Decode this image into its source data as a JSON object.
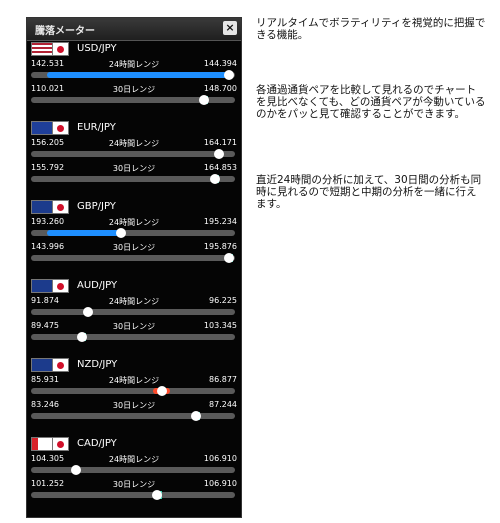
{
  "widget": {
    "title": "騰落メーター",
    "close_label": "×"
  },
  "range_labels": {
    "day": "24時間レンジ",
    "month": "30日レンジ"
  },
  "pairs": [
    {
      "name": "USD/JPY",
      "flag": "us-flag",
      "d_low": "142.531",
      "d_high": "144.394",
      "d_level": 0.97,
      "m_low": "110.021",
      "m_high": "148.700",
      "m_level": 0.85,
      "day_fill": "blue"
    },
    {
      "name": "EUR/JPY",
      "flag": "eu-flag",
      "d_low": "156.205",
      "d_high": "164.171",
      "d_level": 0.92,
      "m_low": "155.792",
      "m_high": "164.853",
      "m_level": 0.9,
      "day_fill": "none"
    },
    {
      "name": "GBP/JPY",
      "flag": "uk-flag",
      "d_low": "193.260",
      "d_high": "195.234",
      "d_level": 0.44,
      "m_low": "143.996",
      "m_high": "195.876",
      "m_level": 0.97,
      "day_fill": "blue"
    },
    {
      "name": "AUD/JPY",
      "flag": "au-flag",
      "d_low": "91.874",
      "d_high": "96.225",
      "d_level": 0.28,
      "m_low": "89.475",
      "m_high": "103.345",
      "m_level": 0.25,
      "day_fill": "none"
    },
    {
      "name": "NZD/JPY",
      "flag": "nz-flag",
      "d_low": "85.931",
      "d_high": "86.877",
      "d_level": 0.64,
      "m_low": "83.246",
      "m_high": "87.244",
      "m_level": 0.81,
      "day_fill": "red"
    },
    {
      "name": "CAD/JPY",
      "flag": "ca-flag",
      "d_low": "104.305",
      "d_high": "106.910",
      "d_level": 0.22,
      "m_low": "101.252",
      "m_high": "106.910",
      "m_level": 0.62,
      "day_fill": "none"
    }
  ],
  "descriptions": [
    "リアルタイムでボラティリティを視覚的に把握できる機能。",
    "各通過通貨ペアを比較して見れるのでチャートを見比べなくても、どの通貨ペアが今動いているのかをパッと見て確認することができます。",
    "直近24時間の分析に加えて、30日間の分析も同時に見れるので短期と中期の分析を一緒に行えます。"
  ]
}
